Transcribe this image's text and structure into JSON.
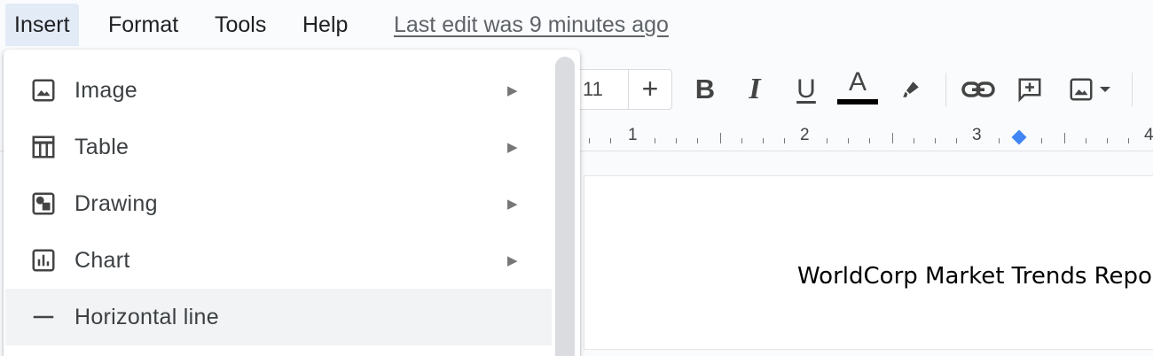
{
  "menubar": {
    "items": [
      {
        "label": "Insert"
      },
      {
        "label": "Format"
      },
      {
        "label": "Tools"
      },
      {
        "label": "Help"
      }
    ],
    "last_edit": "Last edit was 9 minutes ago"
  },
  "toolbar": {
    "font_size": "11",
    "increase_label": "+",
    "bold_label": "B",
    "italic_label": "I",
    "underline_label": "U",
    "text_color_label": "A",
    "text_color": "#000000"
  },
  "ruler": {
    "numbers": [
      "1",
      "2",
      "3",
      "4"
    ],
    "indent_marker_color": "#4285f4"
  },
  "insert_menu": {
    "items": [
      {
        "label": "Image",
        "icon": "image-icon",
        "submenu_arrow": "▶"
      },
      {
        "label": "Table",
        "icon": "table-icon",
        "submenu_arrow": "▶"
      },
      {
        "label": "Drawing",
        "icon": "drawing-icon",
        "submenu_arrow": "▶"
      },
      {
        "label": "Chart",
        "icon": "chart-icon",
        "submenu_arrow": "▶"
      },
      {
        "label": "Horizontal line",
        "icon": "horizontal-line-icon"
      }
    ]
  },
  "document": {
    "title_text": "WorldCorp Market Trends Repo"
  }
}
